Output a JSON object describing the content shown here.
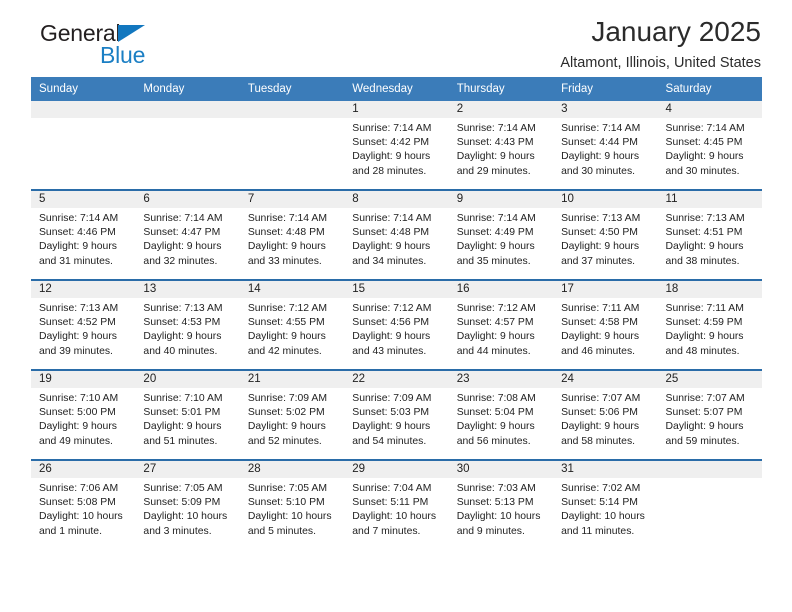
{
  "logo": {
    "word1": "General",
    "word2": "Blue",
    "triangle_color": "#1277bf",
    "word2_color": "#1b7fc4",
    "icon": "triangle-flag-icon"
  },
  "header": {
    "title": "January 2025",
    "subtitle": "Altamont, Illinois, United States"
  },
  "theme": {
    "header_blue": "#3b7cb9",
    "row_separator_blue": "#2a6ca8",
    "daynum_band_gray": "#efefef"
  },
  "weekdays": [
    "Sunday",
    "Monday",
    "Tuesday",
    "Wednesday",
    "Thursday",
    "Friday",
    "Saturday"
  ],
  "weeks": [
    [
      {
        "day": "",
        "sunrise": "",
        "sunset": "",
        "daylight_line1": "",
        "daylight_line2": ""
      },
      {
        "day": "",
        "sunrise": "",
        "sunset": "",
        "daylight_line1": "",
        "daylight_line2": ""
      },
      {
        "day": "",
        "sunrise": "",
        "sunset": "",
        "daylight_line1": "",
        "daylight_line2": ""
      },
      {
        "day": "1",
        "sunrise": "Sunrise: 7:14 AM",
        "sunset": "Sunset: 4:42 PM",
        "daylight_line1": "Daylight: 9 hours",
        "daylight_line2": "and 28 minutes."
      },
      {
        "day": "2",
        "sunrise": "Sunrise: 7:14 AM",
        "sunset": "Sunset: 4:43 PM",
        "daylight_line1": "Daylight: 9 hours",
        "daylight_line2": "and 29 minutes."
      },
      {
        "day": "3",
        "sunrise": "Sunrise: 7:14 AM",
        "sunset": "Sunset: 4:44 PM",
        "daylight_line1": "Daylight: 9 hours",
        "daylight_line2": "and 30 minutes."
      },
      {
        "day": "4",
        "sunrise": "Sunrise: 7:14 AM",
        "sunset": "Sunset: 4:45 PM",
        "daylight_line1": "Daylight: 9 hours",
        "daylight_line2": "and 30 minutes."
      }
    ],
    [
      {
        "day": "5",
        "sunrise": "Sunrise: 7:14 AM",
        "sunset": "Sunset: 4:46 PM",
        "daylight_line1": "Daylight: 9 hours",
        "daylight_line2": "and 31 minutes."
      },
      {
        "day": "6",
        "sunrise": "Sunrise: 7:14 AM",
        "sunset": "Sunset: 4:47 PM",
        "daylight_line1": "Daylight: 9 hours",
        "daylight_line2": "and 32 minutes."
      },
      {
        "day": "7",
        "sunrise": "Sunrise: 7:14 AM",
        "sunset": "Sunset: 4:48 PM",
        "daylight_line1": "Daylight: 9 hours",
        "daylight_line2": "and 33 minutes."
      },
      {
        "day": "8",
        "sunrise": "Sunrise: 7:14 AM",
        "sunset": "Sunset: 4:48 PM",
        "daylight_line1": "Daylight: 9 hours",
        "daylight_line2": "and 34 minutes."
      },
      {
        "day": "9",
        "sunrise": "Sunrise: 7:14 AM",
        "sunset": "Sunset: 4:49 PM",
        "daylight_line1": "Daylight: 9 hours",
        "daylight_line2": "and 35 minutes."
      },
      {
        "day": "10",
        "sunrise": "Sunrise: 7:13 AM",
        "sunset": "Sunset: 4:50 PM",
        "daylight_line1": "Daylight: 9 hours",
        "daylight_line2": "and 37 minutes."
      },
      {
        "day": "11",
        "sunrise": "Sunrise: 7:13 AM",
        "sunset": "Sunset: 4:51 PM",
        "daylight_line1": "Daylight: 9 hours",
        "daylight_line2": "and 38 minutes."
      }
    ],
    [
      {
        "day": "12",
        "sunrise": "Sunrise: 7:13 AM",
        "sunset": "Sunset: 4:52 PM",
        "daylight_line1": "Daylight: 9 hours",
        "daylight_line2": "and 39 minutes."
      },
      {
        "day": "13",
        "sunrise": "Sunrise: 7:13 AM",
        "sunset": "Sunset: 4:53 PM",
        "daylight_line1": "Daylight: 9 hours",
        "daylight_line2": "and 40 minutes."
      },
      {
        "day": "14",
        "sunrise": "Sunrise: 7:12 AM",
        "sunset": "Sunset: 4:55 PM",
        "daylight_line1": "Daylight: 9 hours",
        "daylight_line2": "and 42 minutes."
      },
      {
        "day": "15",
        "sunrise": "Sunrise: 7:12 AM",
        "sunset": "Sunset: 4:56 PM",
        "daylight_line1": "Daylight: 9 hours",
        "daylight_line2": "and 43 minutes."
      },
      {
        "day": "16",
        "sunrise": "Sunrise: 7:12 AM",
        "sunset": "Sunset: 4:57 PM",
        "daylight_line1": "Daylight: 9 hours",
        "daylight_line2": "and 44 minutes."
      },
      {
        "day": "17",
        "sunrise": "Sunrise: 7:11 AM",
        "sunset": "Sunset: 4:58 PM",
        "daylight_line1": "Daylight: 9 hours",
        "daylight_line2": "and 46 minutes."
      },
      {
        "day": "18",
        "sunrise": "Sunrise: 7:11 AM",
        "sunset": "Sunset: 4:59 PM",
        "daylight_line1": "Daylight: 9 hours",
        "daylight_line2": "and 48 minutes."
      }
    ],
    [
      {
        "day": "19",
        "sunrise": "Sunrise: 7:10 AM",
        "sunset": "Sunset: 5:00 PM",
        "daylight_line1": "Daylight: 9 hours",
        "daylight_line2": "and 49 minutes."
      },
      {
        "day": "20",
        "sunrise": "Sunrise: 7:10 AM",
        "sunset": "Sunset: 5:01 PM",
        "daylight_line1": "Daylight: 9 hours",
        "daylight_line2": "and 51 minutes."
      },
      {
        "day": "21",
        "sunrise": "Sunrise: 7:09 AM",
        "sunset": "Sunset: 5:02 PM",
        "daylight_line1": "Daylight: 9 hours",
        "daylight_line2": "and 52 minutes."
      },
      {
        "day": "22",
        "sunrise": "Sunrise: 7:09 AM",
        "sunset": "Sunset: 5:03 PM",
        "daylight_line1": "Daylight: 9 hours",
        "daylight_line2": "and 54 minutes."
      },
      {
        "day": "23",
        "sunrise": "Sunrise: 7:08 AM",
        "sunset": "Sunset: 5:04 PM",
        "daylight_line1": "Daylight: 9 hours",
        "daylight_line2": "and 56 minutes."
      },
      {
        "day": "24",
        "sunrise": "Sunrise: 7:07 AM",
        "sunset": "Sunset: 5:06 PM",
        "daylight_line1": "Daylight: 9 hours",
        "daylight_line2": "and 58 minutes."
      },
      {
        "day": "25",
        "sunrise": "Sunrise: 7:07 AM",
        "sunset": "Sunset: 5:07 PM",
        "daylight_line1": "Daylight: 9 hours",
        "daylight_line2": "and 59 minutes."
      }
    ],
    [
      {
        "day": "26",
        "sunrise": "Sunrise: 7:06 AM",
        "sunset": "Sunset: 5:08 PM",
        "daylight_line1": "Daylight: 10 hours",
        "daylight_line2": "and 1 minute."
      },
      {
        "day": "27",
        "sunrise": "Sunrise: 7:05 AM",
        "sunset": "Sunset: 5:09 PM",
        "daylight_line1": "Daylight: 10 hours",
        "daylight_line2": "and 3 minutes."
      },
      {
        "day": "28",
        "sunrise": "Sunrise: 7:05 AM",
        "sunset": "Sunset: 5:10 PM",
        "daylight_line1": "Daylight: 10 hours",
        "daylight_line2": "and 5 minutes."
      },
      {
        "day": "29",
        "sunrise": "Sunrise: 7:04 AM",
        "sunset": "Sunset: 5:11 PM",
        "daylight_line1": "Daylight: 10 hours",
        "daylight_line2": "and 7 minutes."
      },
      {
        "day": "30",
        "sunrise": "Sunrise: 7:03 AM",
        "sunset": "Sunset: 5:13 PM",
        "daylight_line1": "Daylight: 10 hours",
        "daylight_line2": "and 9 minutes."
      },
      {
        "day": "31",
        "sunrise": "Sunrise: 7:02 AM",
        "sunset": "Sunset: 5:14 PM",
        "daylight_line1": "Daylight: 10 hours",
        "daylight_line2": "and 11 minutes."
      },
      {
        "day": "",
        "sunrise": "",
        "sunset": "",
        "daylight_line1": "",
        "daylight_line2": ""
      }
    ]
  ]
}
